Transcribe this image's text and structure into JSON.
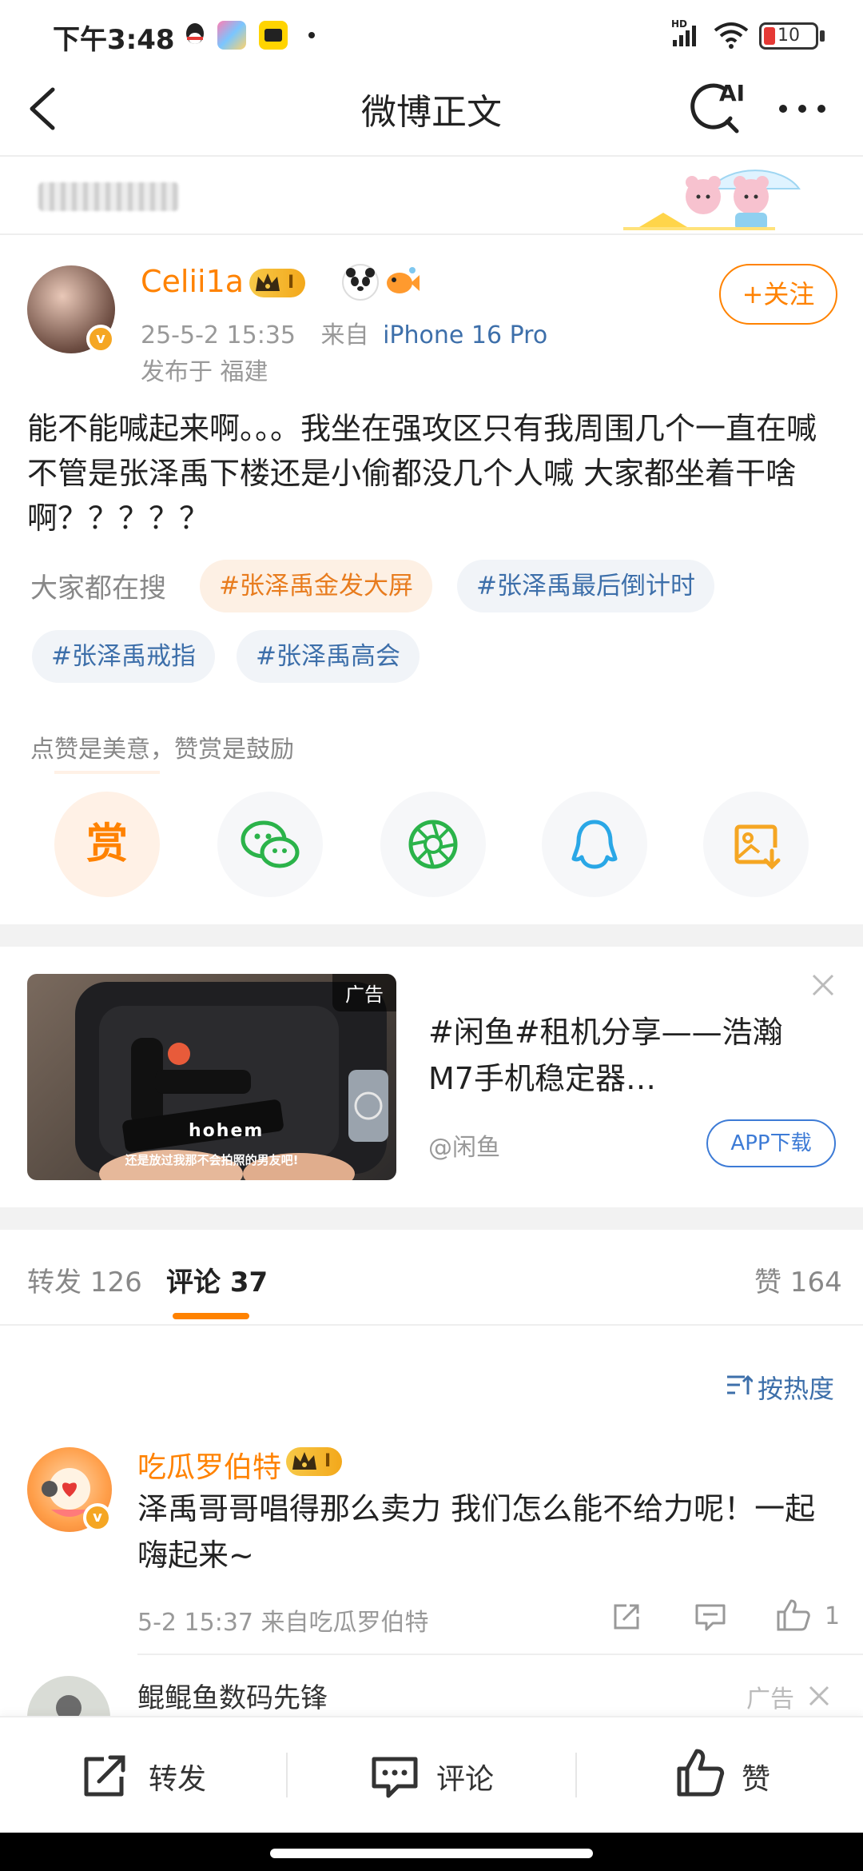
{
  "status_bar": {
    "time": "下午3:48",
    "battery": "10",
    "network": "HD"
  },
  "header": {
    "title": "微博正文",
    "ai_label": "AI"
  },
  "post": {
    "username": "Celii1a",
    "vip_level": "I",
    "timestamp": "25-5-2 15:35",
    "source_prefix": "来自",
    "source_device": "iPhone 16 Pro",
    "location": "发布于 福建",
    "follow_label": "+关注",
    "text": "能不能喊起来啊。。。我坐在强攻区只有我周围几个一直在喊 不管是张泽禹下楼还是小偷都没几个人喊 大家都坐着干啥啊？？？？？",
    "search_label": "大家都在搜",
    "hashtags": [
      "#张泽禹金发大屏",
      "#张泽禹最后倒计时",
      "#张泽禹戒指",
      "#张泽禹高会"
    ],
    "reward_note": "点赞是美意，赞赏是鼓励",
    "reward_button": "赏"
  },
  "ad_card": {
    "tag": "广告",
    "title": "#闲鱼#租机分享——浩瀚M7手机稳定器…",
    "source": "@闲鱼",
    "button": "APP下载",
    "image_caption": "还是放过我那不会拍照的男友吧!",
    "brand_text": "hohem"
  },
  "tabs": {
    "repost": "转发 126",
    "comments": "评论 37",
    "likes": "赞 164"
  },
  "sort_label": "按热度",
  "comment": {
    "username": "吃瓜罗伯特",
    "vip_level": "I",
    "text": "泽禹哥哥唱得那么卖力 我们怎么能不给力呢！一起嗨起来~",
    "meta": "5-2 15:37 来自吃瓜罗伯特",
    "like_count": "1"
  },
  "ad_comment": {
    "name": "鲲鲲鱼数码先锋",
    "tag": "广告"
  },
  "bottom_bar": {
    "repost": "转发",
    "comment": "评论",
    "like": "赞"
  }
}
